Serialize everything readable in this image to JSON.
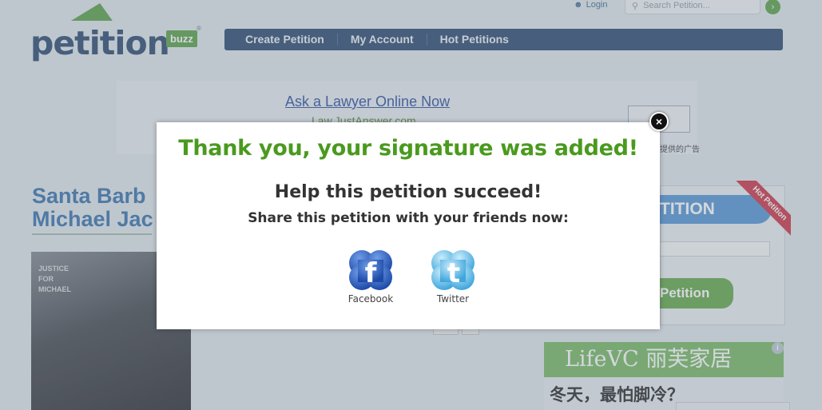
{
  "header": {
    "logo_text": "petition",
    "logo_badge": "buzz",
    "logo_reg": "®",
    "login_label": "Login",
    "search_placeholder": "Search Petition..."
  },
  "nav": {
    "items": [
      "Create Petition",
      "My Account",
      "Hot Petitions"
    ]
  },
  "ad_top": {
    "link": "Ask a Lawyer Online Now",
    "sub": "Law.JustAnswer.com",
    "footer": "提供的广告"
  },
  "petition": {
    "title_line1": "Santa Barb",
    "title_line2": "Michael Jac",
    "photo_caption": [
      "JUSTICE",
      "FOR",
      "MICHAEL"
    ]
  },
  "sidebar": {
    "head": "TITION",
    "ribbon": "Hot Petition",
    "button": "Petition"
  },
  "ad_bottom": {
    "brand": "LifeVC 丽芙家居",
    "text": "冬天，最怕脚冷？",
    "info": "i"
  },
  "modal": {
    "title": "Thank you, your signature was added!",
    "subtitle": "Help this petition succeed!",
    "prompt": "Share this petition with your friends now:",
    "share_buttons": [
      {
        "label": "Facebook",
        "icon": "facebook-icon",
        "color": "#2a5cb4"
      },
      {
        "label": "Twitter",
        "icon": "twitter-icon",
        "color": "#5db6e3"
      }
    ],
    "close_glyph": "×"
  }
}
